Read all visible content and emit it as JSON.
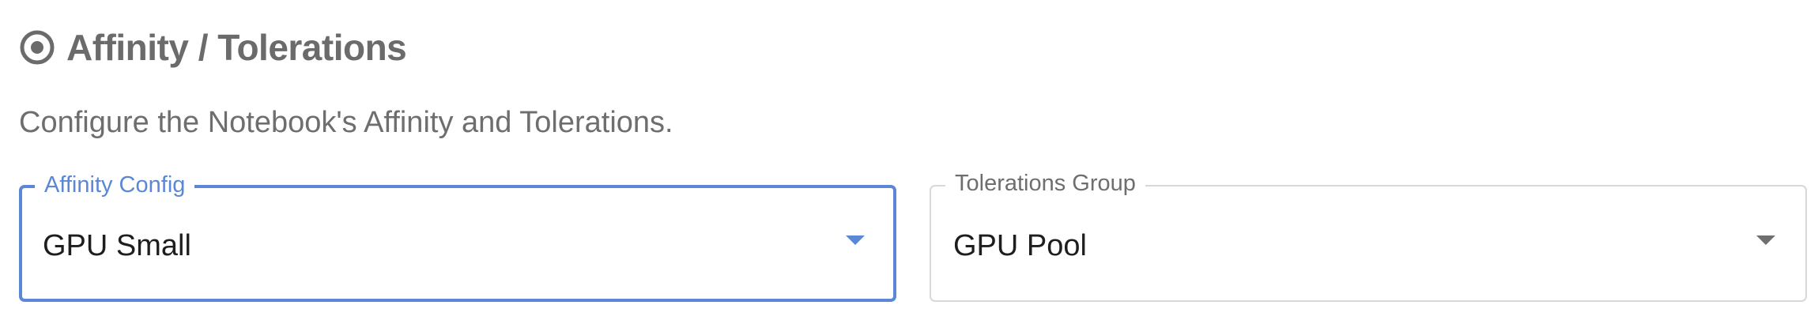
{
  "section": {
    "icon": "target-icon",
    "title": "Affinity / Tolerations",
    "description": "Configure the Notebook's Affinity and Tolerations."
  },
  "fields": {
    "affinity": {
      "label": "Affinity Config",
      "value": "GPU Small",
      "state": "focused",
      "icon": "chevron-down-icon"
    },
    "tolerations": {
      "label": "Tolerations Group",
      "value": "GPU Pool",
      "state": "default",
      "icon": "chevron-down-icon"
    }
  },
  "colors": {
    "accent": "#5c87d6",
    "title_text": "#6b6b6b",
    "secondary_text": "#6e6e6e",
    "value_text": "#1e1e1e",
    "border": "#d8d8d8"
  }
}
